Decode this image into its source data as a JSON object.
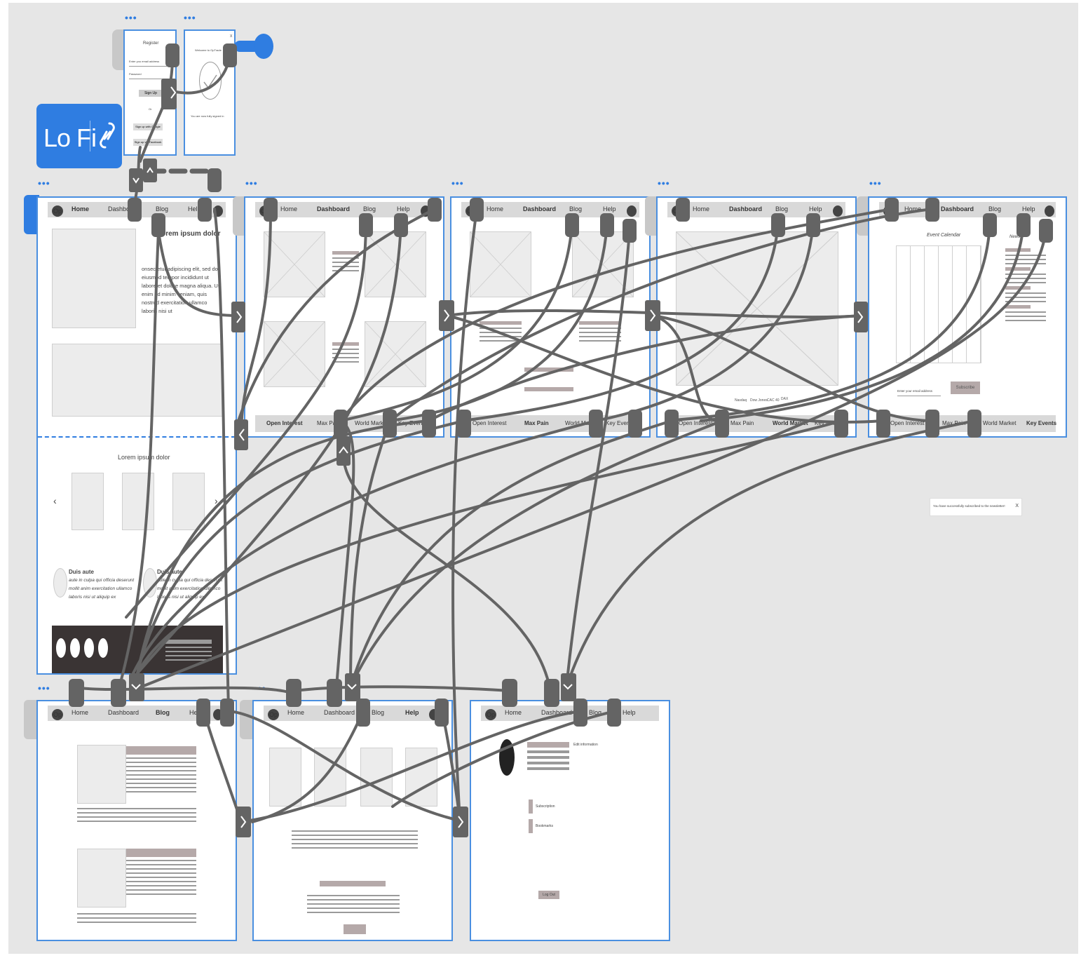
{
  "badge": {
    "label": "Lo Fi",
    "bg": "#2f7de1"
  },
  "artboard_menu": "•••",
  "nav": {
    "home": "Home",
    "dashboard": "Dashboard",
    "blog": "Blog",
    "help": "Help",
    "logo": "Op"
  },
  "register": {
    "title": "Register",
    "email": "Enter you email address",
    "password": "Password",
    "signup": "Sign Up",
    "or": "Or",
    "google": "Sign up with Google",
    "facebook": "Sign up via Facebook"
  },
  "welcome": {
    "title": "Welcome to OpTrade",
    "close": "X",
    "note": "You are now fully signed in"
  },
  "home": {
    "heading": "Lorem ipsum dolor",
    "paragraph": "onsectetur adipiscing elit, sed do eiusmod tempor incididunt ut labore et dolore magna aliqua. Ut enim ad minim veniam, quis nostrud exercitation ullamco laboris nisi ut",
    "carousel_title": "Lorem ipsum dolor",
    "prev": "‹",
    "next": "›",
    "testimonial_name": "Duis aute",
    "testimonial_text": "aute in culpa qui officia deserunt mollit anim exercitation ullamco laboris nisi ut aliquip ex"
  },
  "footer_nav": {
    "open_interest": "Open Interest",
    "max_pain": "Max Pain",
    "world_market": "World Market",
    "key_events": "Key Events"
  },
  "chart": {
    "tickers": [
      "Nasdaq",
      "Dow Jones",
      "CAC 40",
      "DAX"
    ]
  },
  "event_calendar": {
    "title": "Event Calendar",
    "news": "News",
    "subscribe": "Subscribe",
    "email": "Enter your email address"
  },
  "toast": {
    "message": "You have successfully subscribed to the newsletter!",
    "close": "X"
  },
  "profile": {
    "edit": "Edit information",
    "subscription": "Subscription",
    "bookmarks": "Bookmarks",
    "logout": "Log Out"
  }
}
